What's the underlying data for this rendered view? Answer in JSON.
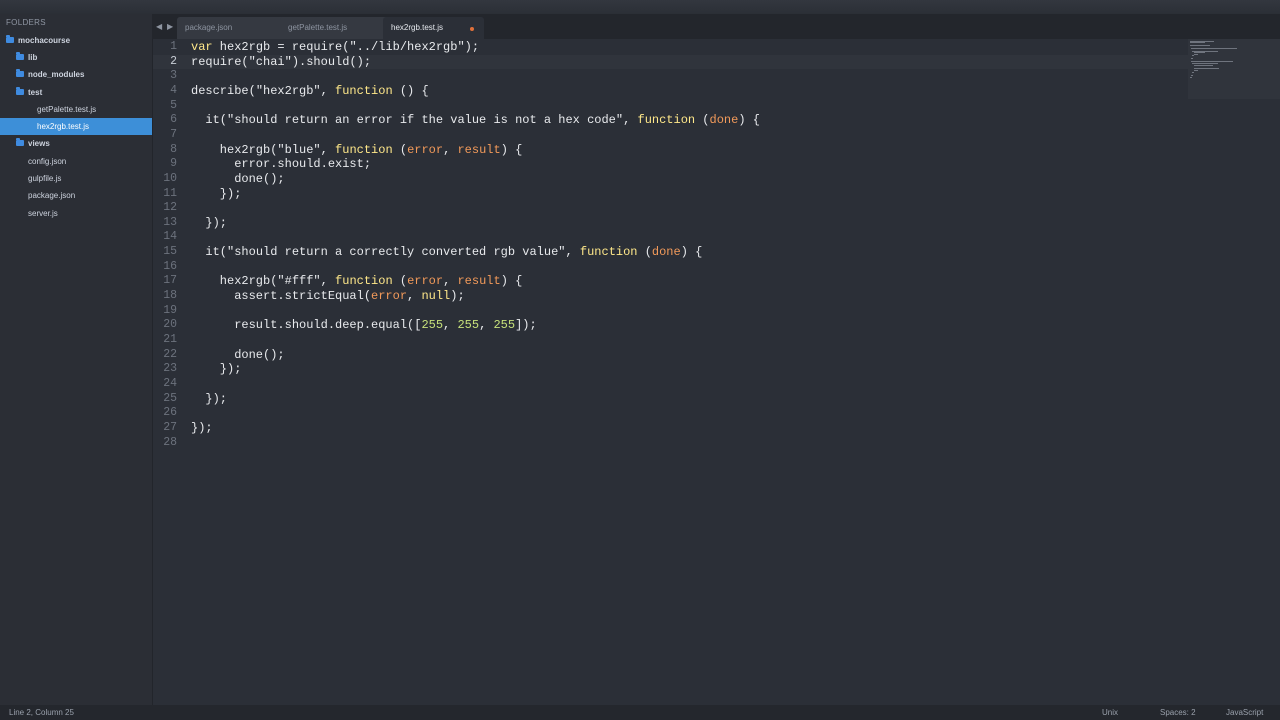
{
  "sidebar": {
    "header": "FOLDERS",
    "items": [
      {
        "label": "mochacourse",
        "type": "folder"
      },
      {
        "label": "lib",
        "type": "folder"
      },
      {
        "label": "node_modules",
        "type": "folder"
      },
      {
        "label": "test",
        "type": "folder"
      },
      {
        "label": "getPalette.test.js",
        "type": "file"
      },
      {
        "label": "hex2rgb.test.js",
        "type": "file",
        "selected": true
      },
      {
        "label": "views",
        "type": "folder"
      },
      {
        "label": "config.json",
        "type": "file"
      },
      {
        "label": "gulpfile.js",
        "type": "file"
      },
      {
        "label": "package.json",
        "type": "file"
      },
      {
        "label": "server.js",
        "type": "file"
      }
    ]
  },
  "tabs": {
    "prev_glyph": "◀",
    "next_glyph": "▶",
    "items": [
      {
        "label": "package.json"
      },
      {
        "label": "getPalette.test.js"
      },
      {
        "label": "hex2rgb.test.js",
        "active": true,
        "modified": true
      }
    ]
  },
  "editor": {
    "current_line": 2,
    "lines": [
      {
        "n": "1",
        "text": "var hex2rgb = require(\"../lib/hex2rgb\");"
      },
      {
        "n": "2",
        "text": "require(\"chai\").should();"
      },
      {
        "n": "3",
        "text": ""
      },
      {
        "n": "4",
        "text": "describe(\"hex2rgb\", function () {"
      },
      {
        "n": "5",
        "text": ""
      },
      {
        "n": "6",
        "text": "  it(\"should return an error if the value is not a hex code\", function (done) {"
      },
      {
        "n": "7",
        "text": ""
      },
      {
        "n": "8",
        "text": "    hex2rgb(\"blue\", function (error, result) {"
      },
      {
        "n": "9",
        "text": "      error.should.exist;"
      },
      {
        "n": "10",
        "text": "      done();"
      },
      {
        "n": "11",
        "text": "    });"
      },
      {
        "n": "12",
        "text": ""
      },
      {
        "n": "13",
        "text": "  });"
      },
      {
        "n": "14",
        "text": ""
      },
      {
        "n": "15",
        "text": "  it(\"should return a correctly converted rgb value\", function (done) {"
      },
      {
        "n": "16",
        "text": ""
      },
      {
        "n": "17",
        "text": "    hex2rgb(\"#fff\", function (error, result) {"
      },
      {
        "n": "18",
        "text": "      assert.strictEqual(error, null);"
      },
      {
        "n": "19",
        "text": ""
      },
      {
        "n": "20",
        "text": "      result.should.deep.equal([255, 255, 255]);"
      },
      {
        "n": "21",
        "text": ""
      },
      {
        "n": "22",
        "text": "      done();"
      },
      {
        "n": "23",
        "text": "    });"
      },
      {
        "n": "24",
        "text": ""
      },
      {
        "n": "25",
        "text": "  });"
      },
      {
        "n": "26",
        "text": ""
      },
      {
        "n": "27",
        "text": "});"
      },
      {
        "n": "28",
        "text": ""
      }
    ]
  },
  "statusbar": {
    "position": "Line 2, Column 25",
    "line_endings": "Unix",
    "indent": "Spaces: 2",
    "syntax": "JavaScript"
  },
  "colors": {
    "keyword": "#ffe88a",
    "parameter": "#f29a5a",
    "number": "#c6e07a",
    "selection": "#3d8fd8",
    "folder_icon": "#3f8be0",
    "modified_dot": "#e0703a"
  }
}
